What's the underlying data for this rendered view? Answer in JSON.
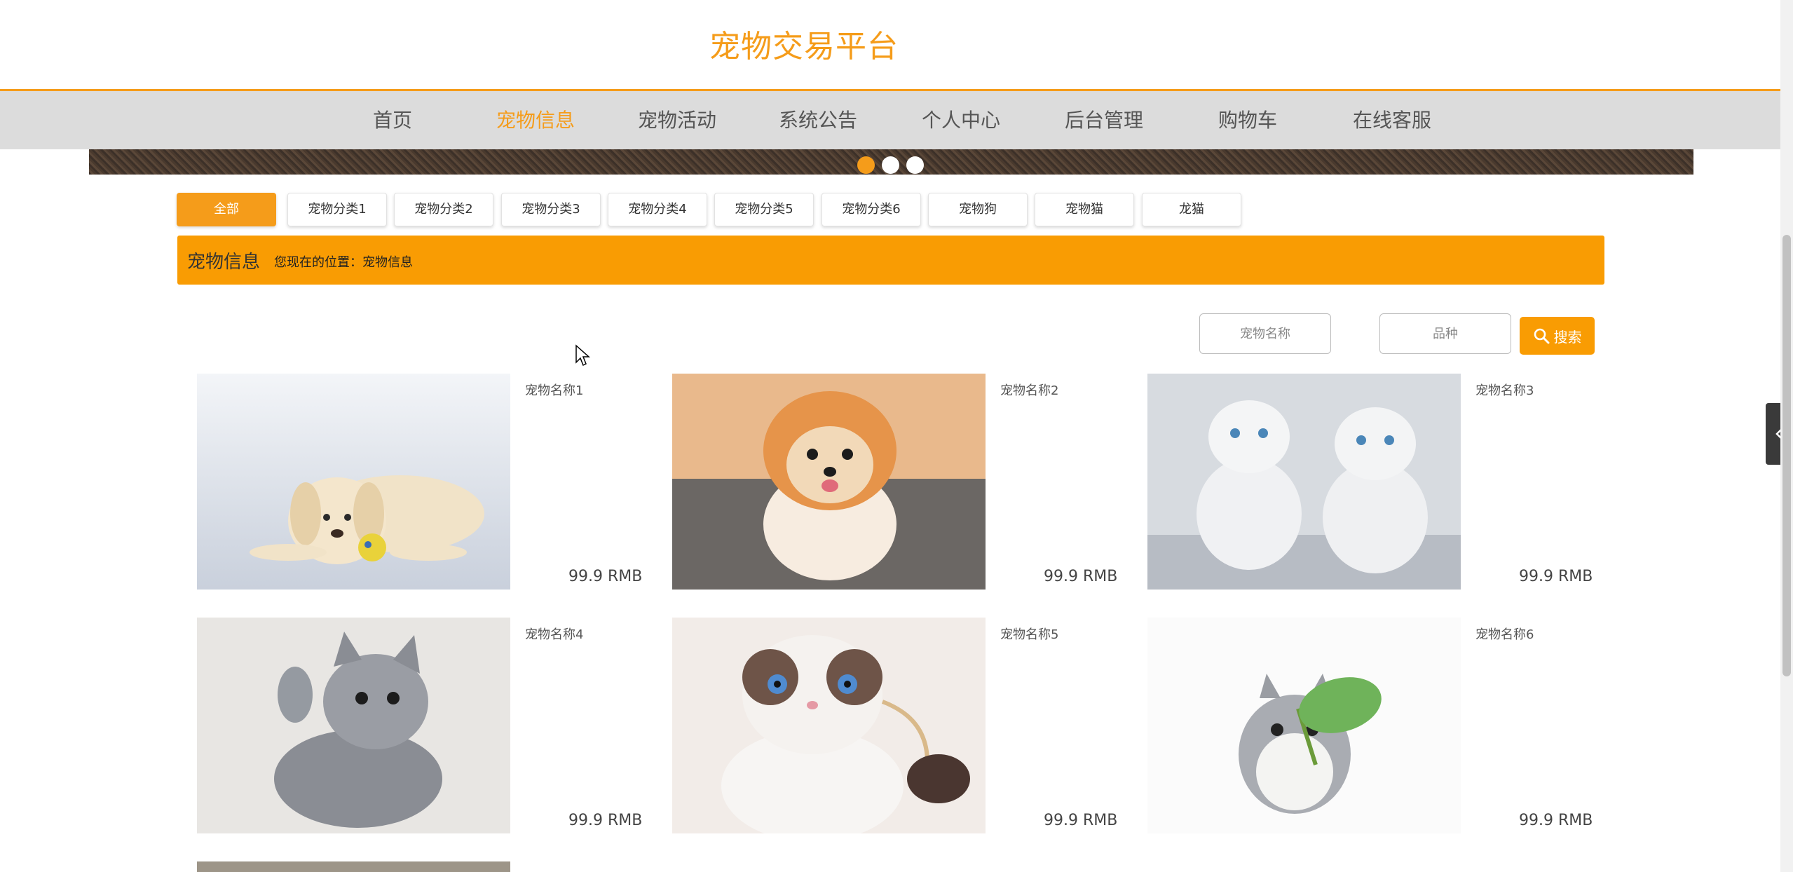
{
  "header": {
    "site_title": "宠物交易平台"
  },
  "nav": {
    "items": [
      "首页",
      "宠物信息",
      "宠物活动",
      "系统公告",
      "个人中心",
      "后台管理",
      "购物车",
      "在线客服"
    ],
    "active": "宠物信息"
  },
  "categories": {
    "items": [
      "全部",
      "宠物分类1",
      "宠物分类2",
      "宠物分类3",
      "宠物分类4",
      "宠物分类5",
      "宠物分类6",
      "宠物狗",
      "宠物猫",
      "龙猫"
    ],
    "active": "全部"
  },
  "breadcrumb": {
    "title": "宠物信息",
    "location": "您现在的位置：宠物信息"
  },
  "search": {
    "name_placeholder": "宠物名称",
    "breed_placeholder": "品种",
    "button_label": "搜索"
  },
  "products": [
    {
      "name": "宠物名称1",
      "price": "99.9 RMB",
      "image": "puppy-photo"
    },
    {
      "name": "宠物名称2",
      "price": "99.9 RMB",
      "image": "pomeranian-photo"
    },
    {
      "name": "宠物名称3",
      "price": "99.9 RMB",
      "image": "kittens-photo"
    },
    {
      "name": "宠物名称4",
      "price": "99.9 RMB",
      "image": "gray-kitten-photo"
    },
    {
      "name": "宠物名称5",
      "price": "99.9 RMB",
      "image": "ragdoll-photo"
    },
    {
      "name": "宠物名称6",
      "price": "99.9 RMB",
      "image": "totoro-plush-photo"
    }
  ],
  "colors": {
    "accent": "#f59c1a",
    "bar": "#f99c03",
    "nav_bg": "#dcdcdc"
  }
}
